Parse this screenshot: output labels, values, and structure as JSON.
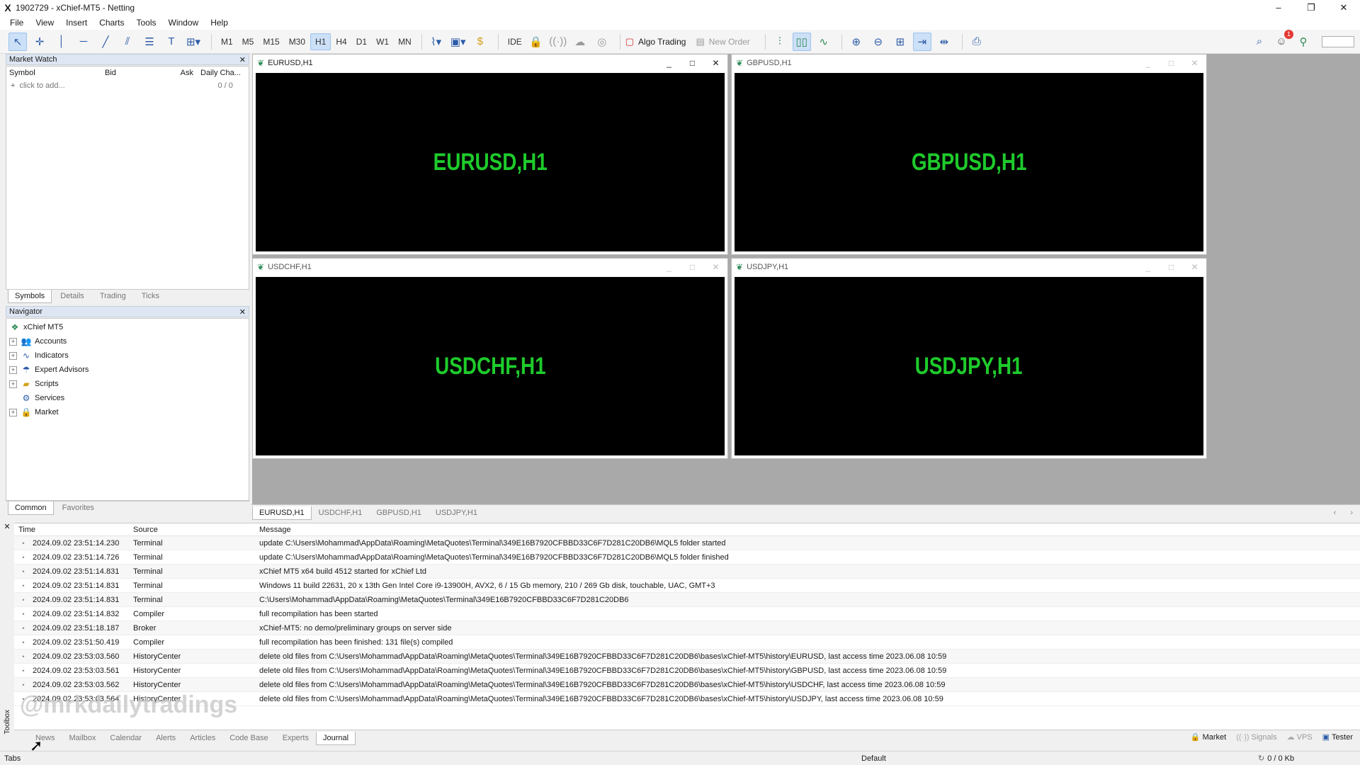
{
  "window": {
    "title": "1902729 - xChief-MT5 - Netting",
    "logo": "X",
    "controls": [
      "–",
      "❐",
      "✕"
    ]
  },
  "menu": [
    "File",
    "View",
    "Insert",
    "Charts",
    "Tools",
    "Window",
    "Help"
  ],
  "toolbar": {
    "timeframes": [
      "M1",
      "M5",
      "M15",
      "M30",
      "H1",
      "H4",
      "D1",
      "W1",
      "MN"
    ],
    "selected_timeframe": "H1",
    "ide_label": "IDE",
    "algo_trading_label": "Algo Trading",
    "new_order_label": "New Order",
    "notification_count": "1"
  },
  "market_watch": {
    "title": "Market Watch",
    "columns": [
      "Symbol",
      "Bid",
      "Ask",
      "Daily Cha..."
    ],
    "add_placeholder": "click to add...",
    "count": "0 / 0",
    "tabs": [
      "Symbols",
      "Details",
      "Trading",
      "Ticks"
    ]
  },
  "navigator": {
    "title": "Navigator",
    "root": "xChief MT5",
    "items": [
      "Accounts",
      "Indicators",
      "Expert Advisors",
      "Scripts",
      "Services",
      "Market"
    ],
    "tabs": [
      "Common",
      "Favorites"
    ]
  },
  "charts": [
    {
      "title": "EURUSD,H1",
      "label": "EURUSD,H1"
    },
    {
      "title": "GBPUSD,H1",
      "label": "GBPUSD,H1"
    },
    {
      "title": "USDCHF,H1",
      "label": "USDCHF,H1"
    },
    {
      "title": "USDJPY,H1",
      "label": "USDJPY,H1"
    }
  ],
  "chart_tabs": [
    "EURUSD,H1",
    "USDCHF,H1",
    "GBPUSD,H1",
    "USDJPY,H1"
  ],
  "journal": {
    "columns": [
      "Time",
      "Source",
      "Message"
    ],
    "rows": [
      {
        "time": "2024.09.02 23:51:14.230",
        "source": "Terminal",
        "message": "update C:\\Users\\Mohammad\\AppData\\Roaming\\MetaQuotes\\Terminal\\349E16B7920CFBBD33C6F7D281C20DB6\\MQL5 folder started"
      },
      {
        "time": "2024.09.02 23:51:14.726",
        "source": "Terminal",
        "message": "update C:\\Users\\Mohammad\\AppData\\Roaming\\MetaQuotes\\Terminal\\349E16B7920CFBBD33C6F7D281C20DB6\\MQL5 folder finished"
      },
      {
        "time": "2024.09.02 23:51:14.831",
        "source": "Terminal",
        "message": "xChief MT5 x64 build 4512 started for xChief Ltd"
      },
      {
        "time": "2024.09.02 23:51:14.831",
        "source": "Terminal",
        "message": "Windows 11 build 22631, 20 x 13th Gen Intel Core i9-13900H, AVX2, 6 / 15 Gb memory, 210 / 269 Gb disk, touchable, UAC, GMT+3"
      },
      {
        "time": "2024.09.02 23:51:14.831",
        "source": "Terminal",
        "message": "C:\\Users\\Mohammad\\AppData\\Roaming\\MetaQuotes\\Terminal\\349E16B7920CFBBD33C6F7D281C20DB6"
      },
      {
        "time": "2024.09.02 23:51:14.832",
        "source": "Compiler",
        "message": "full recompilation has been started"
      },
      {
        "time": "2024.09.02 23:51:18.187",
        "source": "Broker",
        "message": "xChief-MT5: no demo/preliminary groups on server side"
      },
      {
        "time": "2024.09.02 23:51:50.419",
        "source": "Compiler",
        "message": "full recompilation has been finished: 131 file(s) compiled"
      },
      {
        "time": "2024.09.02 23:53:03.560",
        "source": "HistoryCenter",
        "message": "delete old files from C:\\Users\\Mohammad\\AppData\\Roaming\\MetaQuotes\\Terminal\\349E16B7920CFBBD33C6F7D281C20DB6\\bases\\xChief-MT5\\history\\EURUSD, last access time 2023.06.08 10:59"
      },
      {
        "time": "2024.09.02 23:53:03.561",
        "source": "HistoryCenter",
        "message": "delete old files from C:\\Users\\Mohammad\\AppData\\Roaming\\MetaQuotes\\Terminal\\349E16B7920CFBBD33C6F7D281C20DB6\\bases\\xChief-MT5\\history\\GBPUSD, last access time 2023.06.08 10:59"
      },
      {
        "time": "2024.09.02 23:53:03.562",
        "source": "HistoryCenter",
        "message": "delete old files from C:\\Users\\Mohammad\\AppData\\Roaming\\MetaQuotes\\Terminal\\349E16B7920CFBBD33C6F7D281C20DB6\\bases\\xChief-MT5\\history\\USDCHF, last access time 2023.06.08 10:59"
      },
      {
        "time": "2024.09.02 23:53:03.564",
        "source": "HistoryCenter",
        "message": "delete old files from C:\\Users\\Mohammad\\AppData\\Roaming\\MetaQuotes\\Terminal\\349E16B7920CFBBD33C6F7D281C20DB6\\bases\\xChief-MT5\\history\\USDJPY, last access time 2023.06.08 10:59"
      }
    ]
  },
  "toolbox": {
    "label": "Toolbox",
    "tabs": [
      "News",
      "Mailbox",
      "Calendar",
      "Alerts",
      "Articles",
      "Code Base",
      "Experts",
      "Journal"
    ],
    "active_tab": "Journal",
    "right_items": [
      "Market",
      "Signals",
      "VPS",
      "Tester"
    ]
  },
  "status": {
    "left": "Tabs",
    "profile": "Default",
    "traffic": "0 / 0 Kb"
  },
  "watermark": "@mrkdailytradings"
}
